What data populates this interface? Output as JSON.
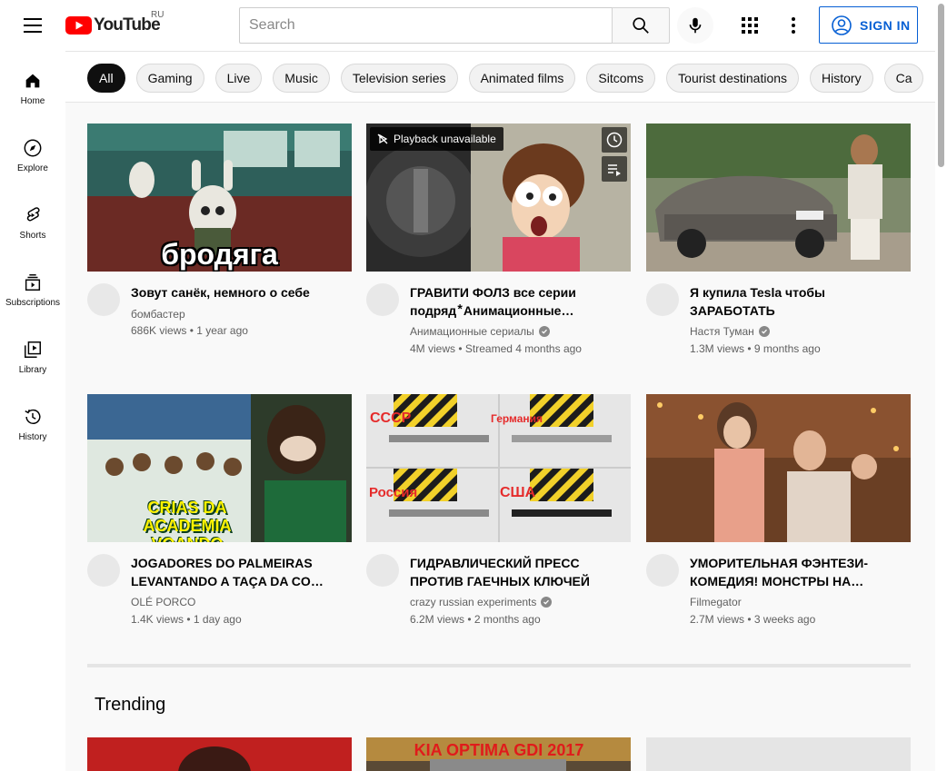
{
  "header": {
    "logo_text": "YouTube",
    "country_code": "RU",
    "search_placeholder": "Search",
    "sign_in_label": "SIGN IN"
  },
  "sidebar": {
    "items": [
      {
        "label": "Home",
        "icon": "home-icon"
      },
      {
        "label": "Explore",
        "icon": "compass-icon"
      },
      {
        "label": "Shorts",
        "icon": "shorts-icon"
      },
      {
        "label": "Subscriptions",
        "icon": "subscriptions-icon"
      },
      {
        "label": "Library",
        "icon": "library-icon"
      },
      {
        "label": "History",
        "icon": "history-icon"
      }
    ]
  },
  "chips": [
    "All",
    "Gaming",
    "Live",
    "Music",
    "Television series",
    "Animated films",
    "Sitcoms",
    "Tourist destinations",
    "History",
    "Ca"
  ],
  "videos": [
    {
      "title": "Зовут санёк, немного о себе",
      "channel": "бомбастер",
      "verified": false,
      "views": "686K views",
      "age": "1 year ago",
      "thumb_text": "бродяга"
    },
    {
      "title": "ГРАВИТИ ФОЛЗ все серии подряд ⃰ Анимационные сериалы",
      "channel": "Анимационные сериалы",
      "verified": true,
      "views": "4M views",
      "age": "Streamed 4 months ago",
      "badge": "Playback unavailable"
    },
    {
      "title": "Я купила Tesla чтобы ЗАРАБОТАТЬ",
      "channel": "Настя Туман",
      "verified": true,
      "views": "1.3M views",
      "age": "9 months ago"
    },
    {
      "title": "JOGADORES DO PALMEIRAS LEVANTANDO A TAÇA DA COPA DO BRASIL",
      "channel": "OLÉ PORCO",
      "verified": false,
      "views": "1.4K views",
      "age": "1 day ago",
      "thumb_text": "CRIAS DA ACADEMIA VOANDO"
    },
    {
      "title": "ГИДРАВЛИЧЕСКИЙ ПРЕСС ПРОТИВ ГАЕЧНЫХ КЛЮЧЕЙ",
      "channel": "crazy russian experiments",
      "verified": true,
      "views": "6.2M views",
      "age": "2 months ago",
      "thumb_labels": [
        "СССР",
        "Германия",
        "Россия",
        "США"
      ]
    },
    {
      "title": "УМОРИТЕЛЬНАЯ ФЭНТЕЗИ-КОМЕДИЯ! МОНСТРЫ НА КАНИКУЛАХ",
      "channel": "Filmegator",
      "verified": false,
      "views": "2.7M views",
      "age": "3 weeks ago"
    }
  ],
  "trending": {
    "title": "Trending",
    "thumb_text": "KIA OPTIMA GDI 2017"
  },
  "colors": {
    "accent": "#065fd4",
    "logo_red": "#ff0000"
  }
}
